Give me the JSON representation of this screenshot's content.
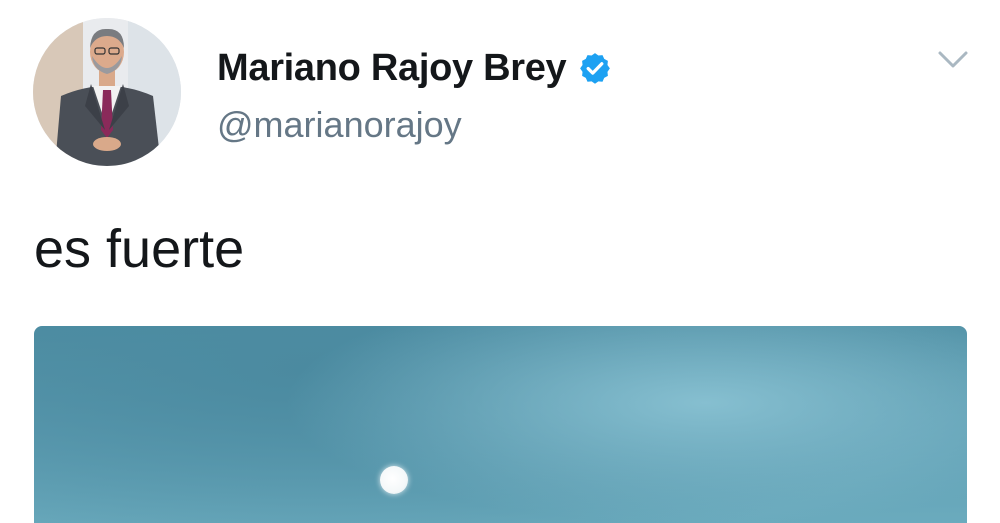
{
  "tweet": {
    "author": {
      "display_name": "Mariano Rajoy Brey",
      "handle": "@marianorajoy",
      "verified": true
    },
    "text": "es fuerte",
    "media": {
      "type": "photo"
    }
  },
  "icons": {
    "verified": "verified-badge-icon",
    "menu": "chevron-down-icon"
  },
  "colors": {
    "verified_blue": "#1da1f2",
    "name_color": "#14171a",
    "handle_color": "#657786",
    "chevron_color": "#aab8c2"
  }
}
